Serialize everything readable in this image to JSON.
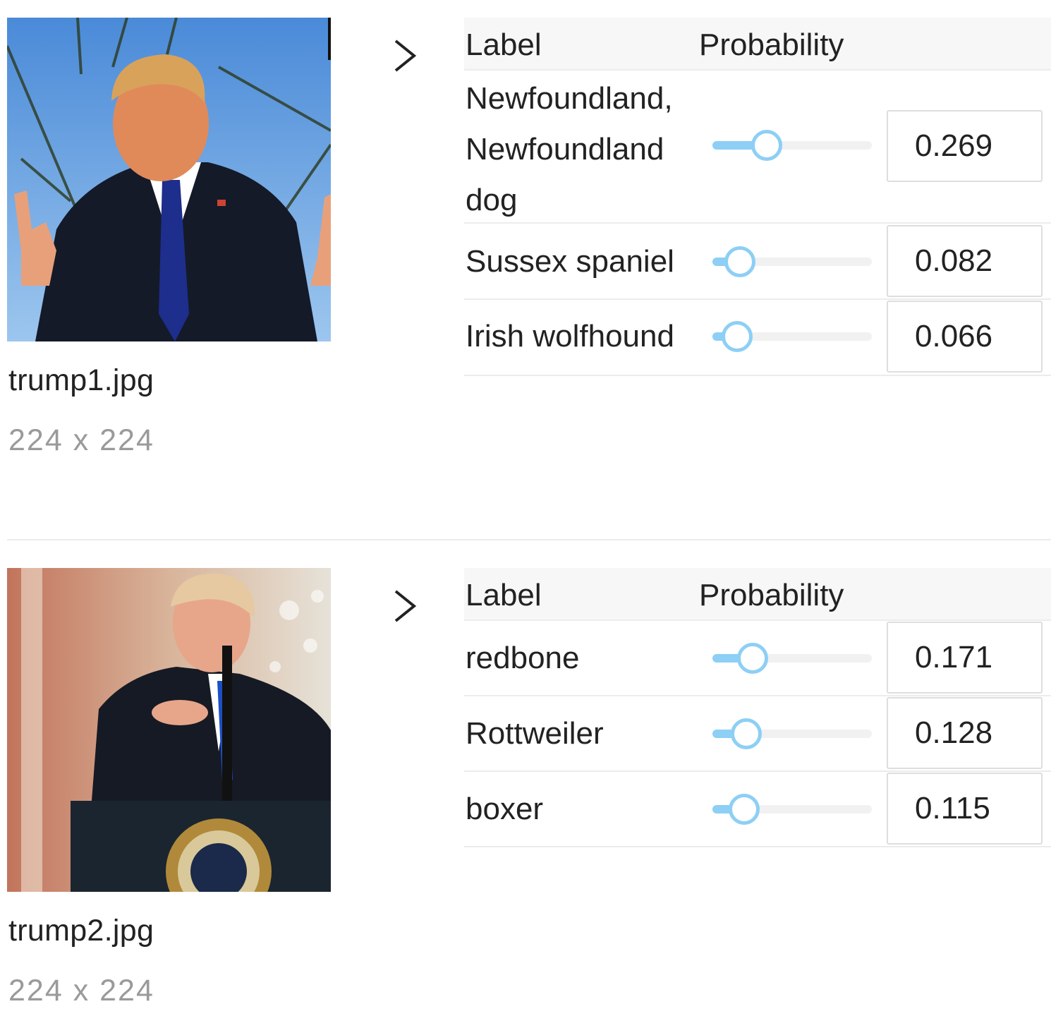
{
  "results": [
    {
      "filename": "trump1.jpg",
      "dimensions": "224 x 224",
      "table": {
        "label_header": "Label",
        "probability_header": "Probability",
        "rows": [
          {
            "label": "Newfoundland, Newfoundland dog",
            "probability": 0.269,
            "display": "0.269"
          },
          {
            "label": "Sussex spaniel",
            "probability": 0.082,
            "display": "0.082"
          },
          {
            "label": "Irish wolfhound",
            "probability": 0.066,
            "display": "0.066"
          }
        ]
      }
    },
    {
      "filename": "trump2.jpg",
      "dimensions": "224 x 224",
      "table": {
        "label_header": "Label",
        "probability_header": "Probability",
        "rows": [
          {
            "label": "redbone",
            "probability": 0.171,
            "display": "0.171"
          },
          {
            "label": "Rottweiler",
            "probability": 0.128,
            "display": "0.128"
          },
          {
            "label": "boxer",
            "probability": 0.115,
            "display": "0.115"
          }
        ]
      }
    }
  ],
  "colors": {
    "slider_accent": "#8dcff5",
    "slider_track": "#f1f1f1"
  },
  "icons": {
    "expand": "chevron-right-icon"
  }
}
